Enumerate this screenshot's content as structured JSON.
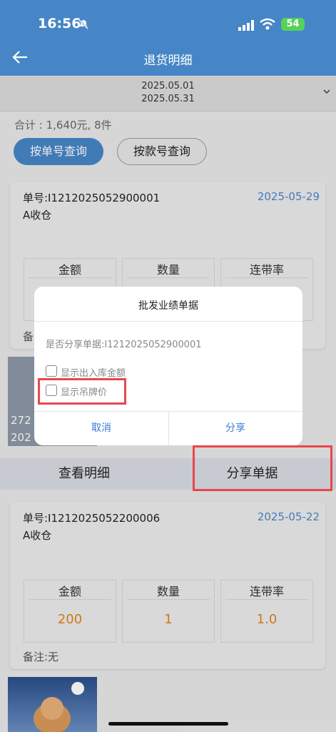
{
  "status": {
    "time": "16:56",
    "battery": "54"
  },
  "header": {
    "title": "退货明细"
  },
  "date_range": {
    "start": "2025.05.01",
    "end": "2025.05.31"
  },
  "summary": "合计 : 1,640元, 8件",
  "buttons": {
    "by_order": "按单号查询",
    "by_style": "按款号查询"
  },
  "cards": [
    {
      "order": "单号:I1212025052900001",
      "date": "2025-05-29",
      "warehouse": "A收仓",
      "headers": [
        "金额",
        "数量",
        "连带率"
      ],
      "values": [],
      "remark": "备"
    },
    {
      "order": "单号:I1212025052200006",
      "date": "2025-05-22",
      "warehouse": "A收仓",
      "headers": [
        "金额",
        "数量",
        "连带率"
      ],
      "values": [
        "200",
        "1",
        "1.0"
      ],
      "remark": "备注:无"
    }
  ],
  "thumb_text": [
    "272",
    "202"
  ],
  "actions": {
    "view_detail": "查看明细",
    "share_doc": "分享单据"
  },
  "dialog": {
    "title": "批发业绩单据",
    "message": "是否分享单据:I1212025052900001",
    "option1": "显示出入库金额",
    "option2": "显示吊牌价",
    "cancel": "取消",
    "share": "分享"
  },
  "colors": {
    "header": "#4686c6",
    "accent": "#e2821e",
    "highlight": "#e8474d",
    "link": "#3a7bd5"
  }
}
